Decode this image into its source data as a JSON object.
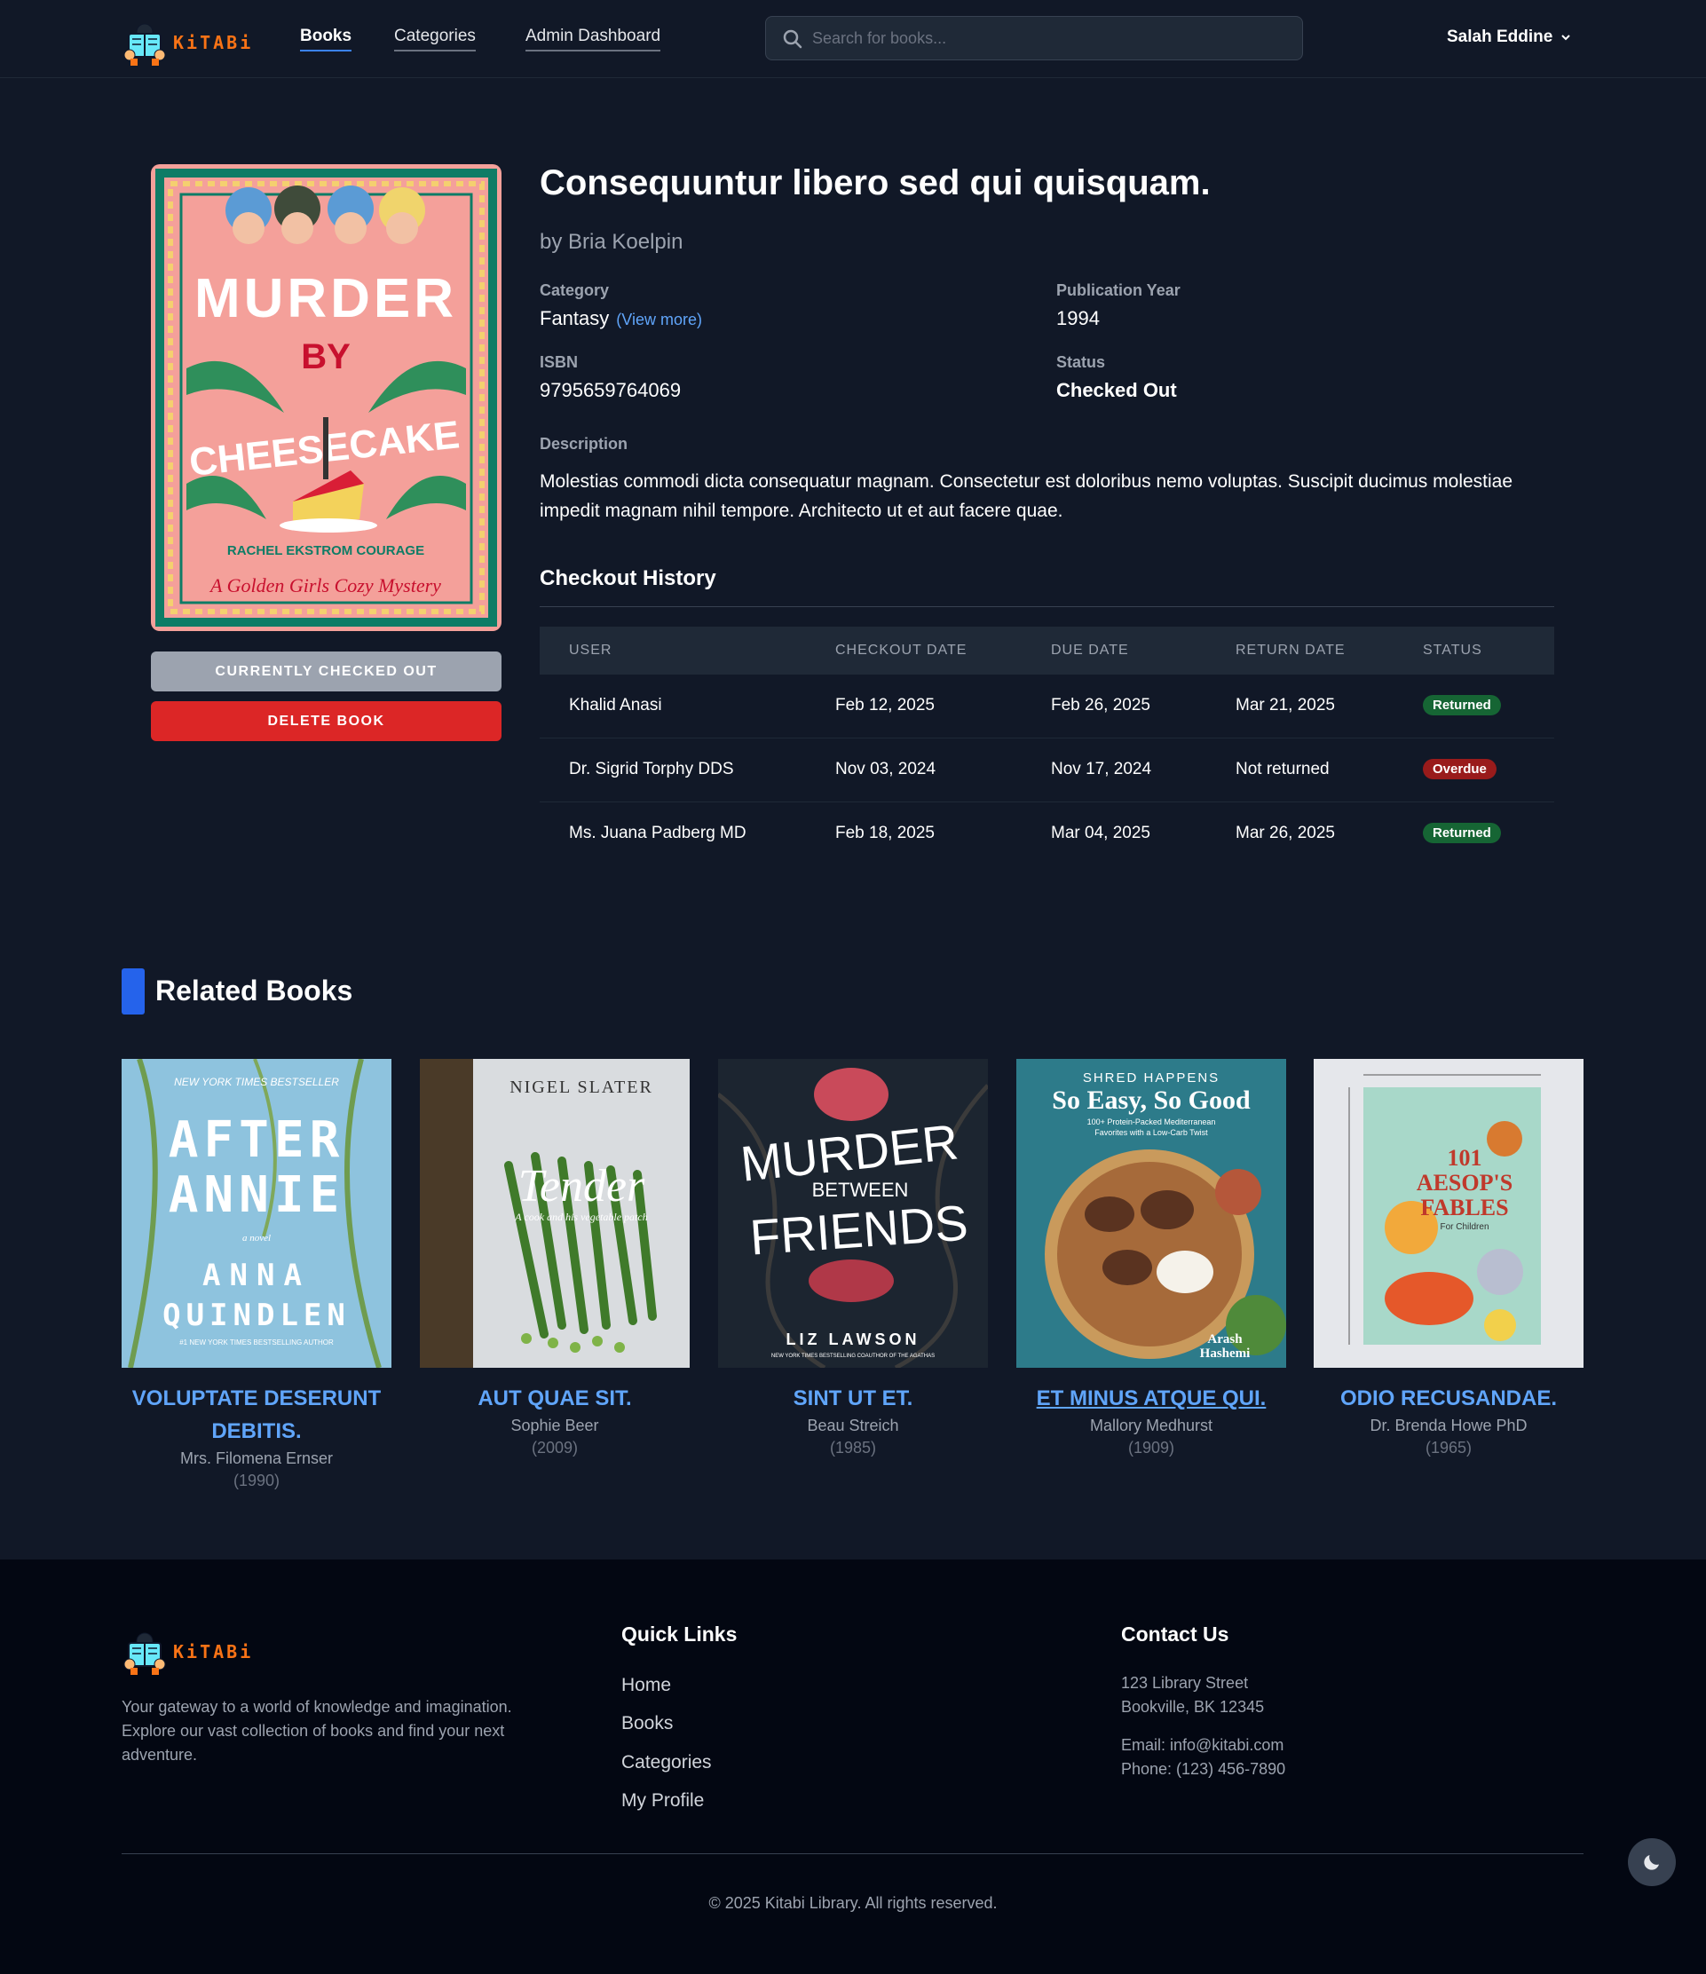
{
  "nav": {
    "brand": "KiTABi",
    "links": [
      {
        "label": "Books",
        "active": true
      },
      {
        "label": "Categories",
        "active": false
      },
      {
        "label": "Admin Dashboard",
        "active": false
      }
    ],
    "search_placeholder": "Search for books...",
    "user_name": "Salah Eddine",
    "icons": {
      "search": "search-icon",
      "user_menu": "chevron-down-icon"
    }
  },
  "book": {
    "title": "Consequuntur libero sed qui quisquam.",
    "author": "by Bria Koelpin",
    "category_label": "Category",
    "category": "Fantasy",
    "view_more": "(View more)",
    "pub_year_label": "Publication Year",
    "pub_year": "1994",
    "isbn_label": "ISBN",
    "isbn": "9795659764069",
    "status_label": "Status",
    "status": "Checked Out",
    "description_label": "Description",
    "description": "Molestias commodi dicta consequatur magnam. Consectetur est doloribus nemo voluptas. Suscipit ducimus molestiae impedit magnam nihil tempore. Architecto ut et aut facere quae.",
    "cover": {
      "top_text": "MURDER",
      "by_text": "BY",
      "big_text": "CHEESECAKE",
      "author_text": "RACHEL EKSTROM COURAGE",
      "subtitle_text": "A Golden Girls Cozy Mystery"
    },
    "checked_out_button": "CURRENTLY CHECKED OUT",
    "delete_button": "DELETE BOOK"
  },
  "history": {
    "title": "Checkout History",
    "columns": [
      "USER",
      "CHECKOUT DATE",
      "DUE DATE",
      "RETURN DATE",
      "STATUS"
    ],
    "rows": [
      {
        "user": "Khalid Anasi",
        "checkout": "Feb 12, 2025",
        "due": "Feb 26, 2025",
        "return": "Mar 21, 2025",
        "status": "Returned",
        "status_color": "#166534"
      },
      {
        "user": "Dr. Sigrid Torphy DDS",
        "checkout": "Nov 03, 2024",
        "due": "Nov 17, 2024",
        "return": "Not returned",
        "status": "Overdue",
        "status_color": "#991b1b"
      },
      {
        "user": "Ms. Juana Padberg MD",
        "checkout": "Feb 18, 2025",
        "due": "Mar 04, 2025",
        "return": "Mar 26, 2025",
        "status": "Returned",
        "status_color": "#166534"
      }
    ]
  },
  "related": {
    "title": "Related Books",
    "books": [
      {
        "title": "VOLUPTATE DESERUNT DEBITIS.",
        "author": "Mrs. Filomena Ernser",
        "year": "(1990)",
        "cover_lines": [
          "NEW YORK TIMES BESTSELLER",
          "AFTER",
          "ANNIE",
          "a novel",
          "ANNA",
          "QUINDLEN",
          "#1 NEW YORK TIMES BESTSELLING AUTHOR"
        ]
      },
      {
        "title": "AUT QUAE SIT.",
        "author": "Sophie Beer",
        "year": "(2009)",
        "cover_lines": [
          "NIGEL SLATER",
          "Tender",
          "A cook and his vegetable patch"
        ]
      },
      {
        "title": "SINT UT ET.",
        "author": "Beau Streich",
        "year": "(1985)",
        "cover_lines": [
          "MURDER",
          "BETWEEN",
          "FRIENDS",
          "LIZ LAWSON",
          "NEW YORK TIMES BESTSELLING COAUTHOR OF THE AGATHAS"
        ]
      },
      {
        "title": "ET MINUS ATQUE QUI.",
        "author": "Mallory Medhurst",
        "year": "(1909)",
        "cover_lines": [
          "SHRED HAPPENS",
          "So Easy, So Good",
          "100+ Protein-Packed Mediterranean",
          "Favorites with a Low-Carb Twist",
          "Arash",
          "Hashemi"
        ]
      },
      {
        "title": "ODIO RECUSANDAE.",
        "author": "Dr. Brenda Howe PhD",
        "year": "(1965)",
        "cover_lines": [
          "101",
          "AESOP'S",
          "FABLES",
          "For Children"
        ]
      }
    ]
  },
  "footer": {
    "brand": "KiTABi",
    "tagline": "Your gateway to a world of knowledge and imagination. Explore our vast collection of books and find your next adventure.",
    "quick_links_title": "Quick Links",
    "quick_links": [
      "Home",
      "Books",
      "Categories",
      "My Profile"
    ],
    "contact_title": "Contact Us",
    "address_line1": "123 Library Street",
    "address_line2": "Bookville, BK 12345",
    "email": "Email: info@kitabi.com",
    "phone": "Phone: (123) 456-7890",
    "copyright": "© 2025 Kitabi Library. All rights reserved.",
    "theme_toggle_icon": "moon-icon"
  },
  "colors": {
    "background": "#111827",
    "footer": "#030712",
    "accent": "#3b82f6",
    "link": "#60a5fa",
    "danger": "#dc2626",
    "brand_orange": "#f97316"
  }
}
